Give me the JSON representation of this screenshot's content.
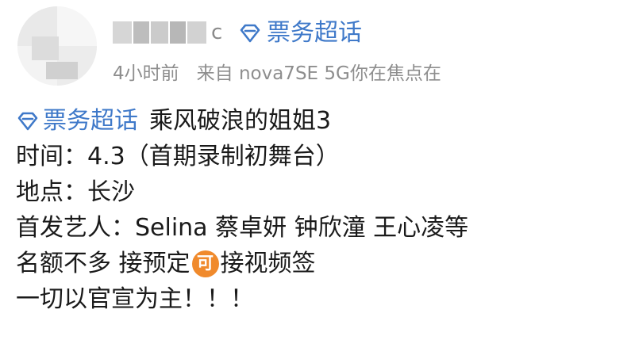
{
  "post": {
    "name_tail": "c",
    "super_topic_label": "票务超话",
    "time": "4小时前",
    "source": "来自 nova7SE 5G你在焦点在"
  },
  "content": {
    "topic_label": "票务超话",
    "line1_rest": "乘风破浪的姐姐3",
    "line2": "时间：4.3（首期录制初舞台）",
    "line3": "地点：长沙",
    "line4": "首发艺人：Selina 蔡卓妍 钟欣潼 王心凌等",
    "line5_before": "名额不多 接预定",
    "line5_badge": "可",
    "line5_after": "接视频签",
    "line6": "一切以官宣为主！！！"
  },
  "colors": {
    "link_blue": "#3f79c9",
    "meta_gray": "#8e8e8e",
    "badge_orange": "#f08a2c"
  },
  "icons": {
    "avatar": "avatar",
    "super_topic": "diamond-icon",
    "badge": "ke-badge"
  }
}
